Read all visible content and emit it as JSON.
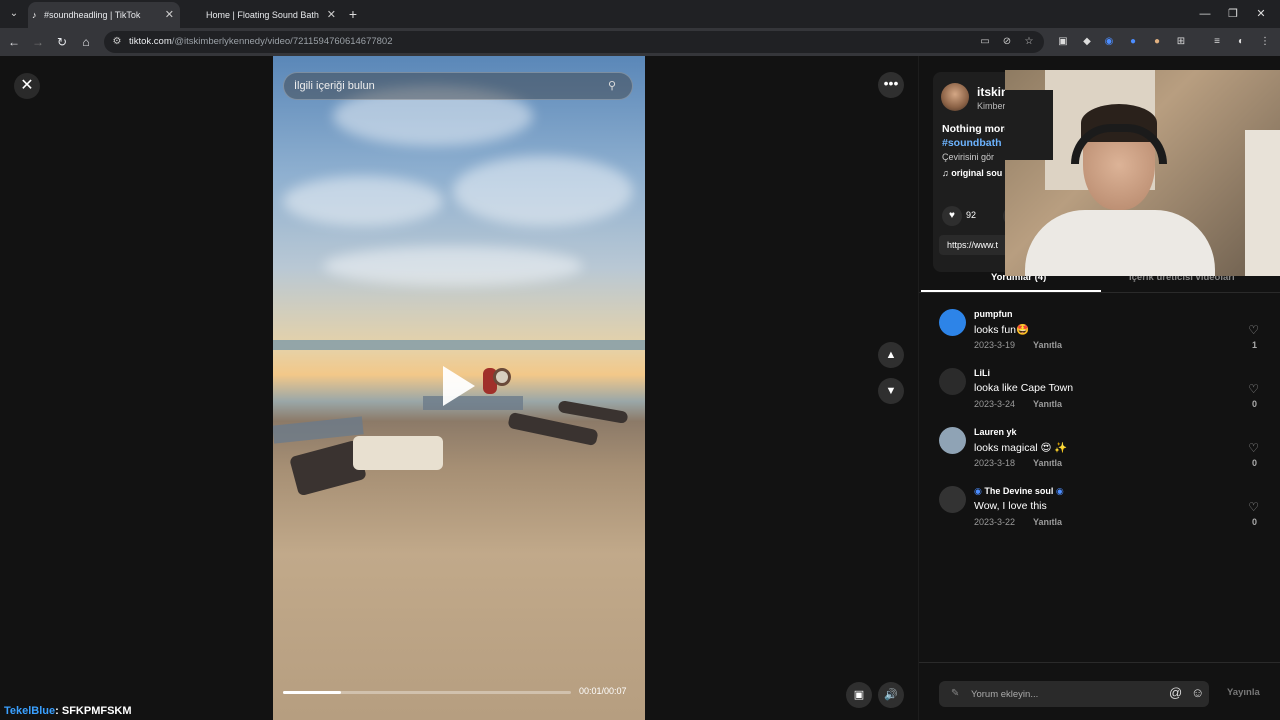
{
  "browser": {
    "tabs": [
      {
        "title": "#soundheadling | TikTok",
        "active": true
      },
      {
        "title": "Home | Floating Sound Bath",
        "active": false
      }
    ],
    "url_domain": "tiktok.com",
    "url_path": "/@itskimberlykennedy/video/7211594760614677802"
  },
  "video": {
    "search_placeholder": "İlgili içeriği bulun",
    "time": "00:01/00:07",
    "progress_fraction": 0.2
  },
  "author": {
    "name": "itskim",
    "subtitle": "Kimber",
    "description": "Nothing more",
    "hashtag": "#soundbath",
    "translate": "Çevirisini gör",
    "music": "original sou",
    "likes": "92",
    "link": "https://www.t"
  },
  "panel_tabs": {
    "comments": "Yorumlar (4)",
    "creator_videos": "İçerik üreticisi videoları"
  },
  "comments": [
    {
      "user": "pumpfun",
      "text": "looks fun🤩",
      "date": "2023-3-19",
      "reply": "Yanıtla",
      "likes": "1",
      "avatar_color": "#2d84e8"
    },
    {
      "user": "LiLi",
      "text": "looka like Cape Town",
      "date": "2023-3-24",
      "reply": "Yanıtla",
      "likes": "0",
      "avatar_color": "#2b2b2b"
    },
    {
      "user": "Lauren yk",
      "text": "looks magical 😍 ✨",
      "date": "2023-3-18",
      "reply": "Yanıtla",
      "likes": "0",
      "avatar_color": "#8fa3b5"
    },
    {
      "user": "The Devine soul",
      "text": "Wow, I love this",
      "date": "2023-3-22",
      "reply": "Yanıtla",
      "likes": "0",
      "avatar_color": "#333333"
    }
  ],
  "composer": {
    "placeholder": "Yorum ekleyin...",
    "post": "Yayınla"
  },
  "stream": {
    "name": "TekelBlue",
    "message": ": SFKPMFSKM"
  }
}
